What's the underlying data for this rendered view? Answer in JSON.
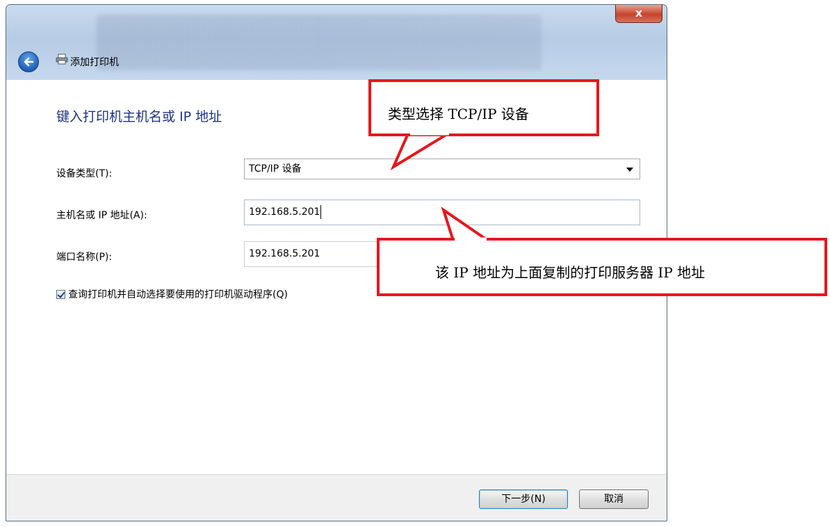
{
  "window": {
    "title": "添加打印机",
    "close_symbol": "x"
  },
  "page": {
    "heading": "键入打印机主机名或 IP 地址"
  },
  "form": {
    "device_type_label": "设备类型(T):",
    "device_type_value": "TCP/IP 设备",
    "host_label": "主机名或 IP 地址(A):",
    "host_value": "192.168.5.201",
    "port_label": "端口名称(P):",
    "port_value": "192.168.5.201",
    "query_checkbox_label": "查询打印机并自动选择要使用的打印机驱动程序(Q)",
    "query_checked": true
  },
  "buttons": {
    "next": "下一步(N)",
    "cancel": "取消"
  },
  "annotations": {
    "type_callout": "类型选择 TCP/IP 设备",
    "ip_callout": "该 IP 地址为上面复制的打印服务器 IP 地址",
    "color": "#e8161b"
  },
  "icons": [
    "back-arrow-icon",
    "printer-icon",
    "close-icon",
    "dropdown-arrow-icon",
    "checkbox-check-icon"
  ]
}
